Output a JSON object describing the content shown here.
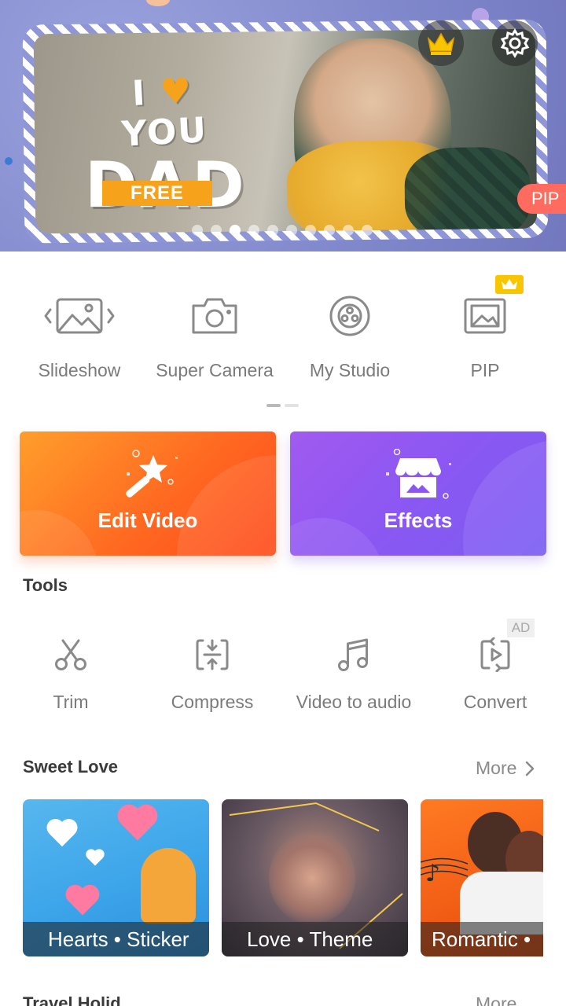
{
  "banner": {
    "promo_line1_a": "I",
    "promo_line1_heart": "♥",
    "promo_line1_b": "YOU",
    "promo_line2": "DAD",
    "badge": "FREE",
    "pip_tag": "PIP",
    "dots_total": 10,
    "dots_active_index": 2
  },
  "quick_actions": [
    {
      "label": "Slideshow",
      "icon": "slideshow-icon"
    },
    {
      "label": "Super Camera",
      "icon": "camera-icon"
    },
    {
      "label": "My Studio",
      "icon": "film-reel-icon"
    },
    {
      "label": "PIP",
      "icon": "pip-icon"
    }
  ],
  "cards": {
    "edit": {
      "label": "Edit Video",
      "icon": "magic-wand-icon"
    },
    "effects": {
      "label": "Effects",
      "icon": "store-icon"
    }
  },
  "tools": {
    "title": "Tools",
    "ad_badge": "AD",
    "items": [
      {
        "label": "Trim",
        "icon": "scissors-icon"
      },
      {
        "label": "Compress",
        "icon": "compress-icon"
      },
      {
        "label": "Video to audio",
        "icon": "music-note-icon"
      },
      {
        "label": "Convert",
        "icon": "convert-icon"
      }
    ]
  },
  "sweet_love": {
    "title": "Sweet Love",
    "more": "More",
    "items": [
      {
        "caption": "Hearts • Sticker"
      },
      {
        "caption": "Love • Theme"
      },
      {
        "caption": "Romantic •"
      }
    ]
  },
  "next_section": {
    "title": "Travel Holid",
    "more": "More"
  },
  "colors": {
    "edit_card": "#ff6a21",
    "effects_card": "#8b57f2",
    "vip_gold": "#f8c600",
    "pip_tag": "#ff6b5e",
    "label_gray": "#7b7b7b"
  }
}
